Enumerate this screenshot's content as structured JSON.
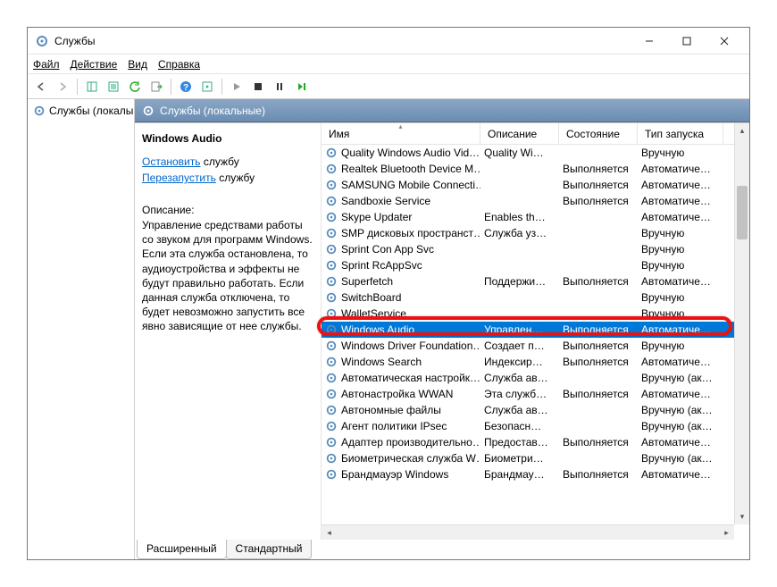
{
  "title": "Службы",
  "menu": {
    "file": "Файл",
    "action": "Действие",
    "view": "Вид",
    "help": "Справка"
  },
  "tree": {
    "root": "Службы (локалы"
  },
  "panel_header": "Службы (локальные)",
  "detail": {
    "title": "Windows Audio",
    "stop_link": "Остановить",
    "stop_tail": " службу",
    "restart_link": "Перезапустить",
    "restart_tail": " службу",
    "desc_label": "Описание:",
    "desc": "Управление средствами работы со звуком для программ Windows. Если эта служба остановлена, то аудиоустройства и эффекты не будут правильно работать. Если данная служба отключена, то будет невозможно запустить все явно зависящие от нее службы."
  },
  "columns": {
    "name": "Имя",
    "desc": "Описание",
    "state": "Состояние",
    "start": "Тип запуска"
  },
  "services": [
    {
      "name": "Quality Windows Audio Vid…",
      "desc": "Quality Wi…",
      "state": "",
      "start": "Вручную"
    },
    {
      "name": "Realtek Bluetooth Device M…",
      "desc": "",
      "state": "Выполняется",
      "start": "Автоматиче…"
    },
    {
      "name": "SAMSUNG Mobile Connecti…",
      "desc": "",
      "state": "Выполняется",
      "start": "Автоматиче…"
    },
    {
      "name": "Sandboxie Service",
      "desc": "",
      "state": "Выполняется",
      "start": "Автоматиче…"
    },
    {
      "name": "Skype Updater",
      "desc": "Enables th…",
      "state": "",
      "start": "Автоматиче…"
    },
    {
      "name": "SMP дисковых пространст…",
      "desc": "Служба уз…",
      "state": "",
      "start": "Вручную"
    },
    {
      "name": "Sprint Con App Svc",
      "desc": "",
      "state": "",
      "start": "Вручную"
    },
    {
      "name": "Sprint RcAppSvc",
      "desc": "",
      "state": "",
      "start": "Вручную"
    },
    {
      "name": "Superfetch",
      "desc": "Поддержи…",
      "state": "Выполняется",
      "start": "Автоматиче…"
    },
    {
      "name": "SwitchBoard",
      "desc": "",
      "state": "",
      "start": "Вручную"
    },
    {
      "name": "WalletService",
      "desc": "",
      "state": "",
      "start": "Вручную"
    },
    {
      "name": "Windows Audio",
      "desc": "Управлен…",
      "state": "Выполняется",
      "start": "Автоматиче…",
      "selected": true
    },
    {
      "name": "Windows Driver Foundation…",
      "desc": "Создает п…",
      "state": "Выполняется",
      "start": "Вручную"
    },
    {
      "name": "Windows Search",
      "desc": "Индексир…",
      "state": "Выполняется",
      "start": "Автоматиче…"
    },
    {
      "name": "Автоматическая настройк…",
      "desc": "Служба ав…",
      "state": "",
      "start": "Вручную (ак…"
    },
    {
      "name": "Автонастройка WWAN",
      "desc": "Эта служб…",
      "state": "Выполняется",
      "start": "Автоматиче…"
    },
    {
      "name": "Автономные файлы",
      "desc": "Служба ав…",
      "state": "",
      "start": "Вручную (ак…"
    },
    {
      "name": "Агент политики IPsec",
      "desc": "Безопасн…",
      "state": "",
      "start": "Вручную (ак…"
    },
    {
      "name": "Адаптер производительно…",
      "desc": "Предостав…",
      "state": "Выполняется",
      "start": "Автоматиче…"
    },
    {
      "name": "Биометрическая служба W…",
      "desc": "Биометри…",
      "state": "",
      "start": "Вручную (ак…"
    },
    {
      "name": "Брандмауэр Windows",
      "desc": "Брандмау…",
      "state": "Выполняется",
      "start": "Автоматиче…"
    }
  ],
  "tabs": {
    "extended": "Расширенный",
    "standard": "Стандартный"
  }
}
